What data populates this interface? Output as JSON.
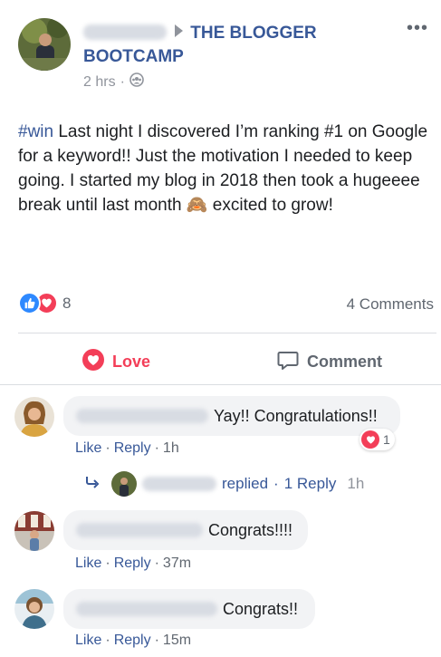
{
  "post": {
    "group_name": "THE BLOGGER BOOTCAMP",
    "time": "2 hrs",
    "separator": "·",
    "hashtag": "#win",
    "body": " Last night I discovered I’m ranking #1 on Google for a keyword!! Just the motivation I needed to keep going. I started my blog in 2018 then took a hugeeee break until last month 🙈 excited to grow!",
    "reaction_count": "8",
    "comments_count": "4 Comments",
    "love_label": "Love",
    "comment_label": "Comment",
    "more_label": "•••"
  },
  "comments": [
    {
      "text": "Yay!! Congratulations!!",
      "like": "Like",
      "reply": "Reply",
      "time": "1h",
      "reaction_count": "1"
    },
    {
      "text": "Congrats!!!!",
      "like": "Like",
      "reply": "Reply",
      "time": "37m"
    },
    {
      "text": "Congrats!!",
      "like": "Like",
      "reply": "Reply",
      "time": "15m"
    }
  ],
  "replies": {
    "replied": "replied",
    "separator": "·",
    "count_label": "1 Reply",
    "time": "1h"
  },
  "colors": {
    "brand": "#385898",
    "love": "#f33e58",
    "like": "#2e89ff"
  }
}
